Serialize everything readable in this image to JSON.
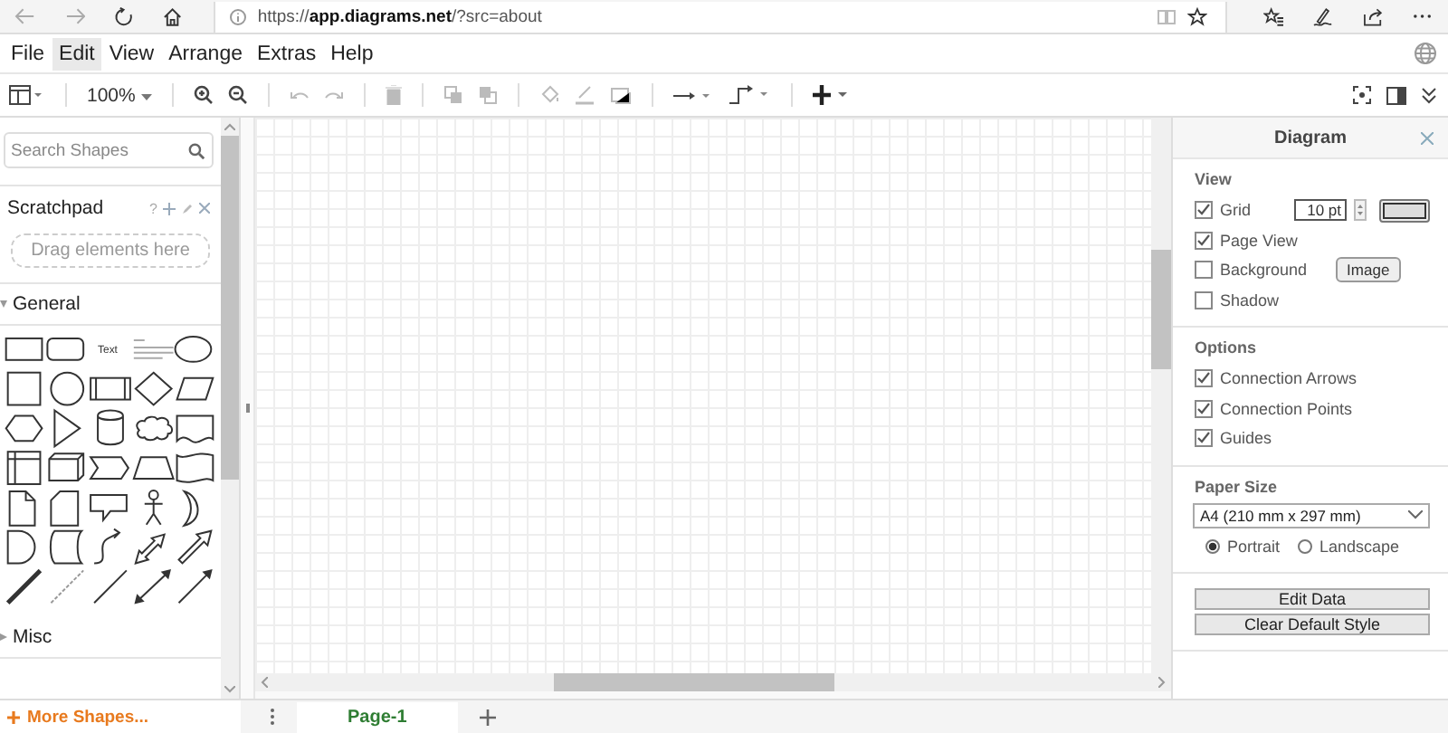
{
  "browser": {
    "url": "https://**app.diagrams.net**/?src=about"
  },
  "menu": [
    {
      "label": "File",
      "selected": false
    },
    {
      "label": "Edit",
      "selected": true
    },
    {
      "label": "View",
      "selected": false
    },
    {
      "label": "Arrange",
      "selected": false
    },
    {
      "label": "Extras",
      "selected": false
    },
    {
      "label": "Help",
      "selected": false
    }
  ],
  "toolbar": {
    "zoom": "100%"
  },
  "sidebar": {
    "search": {
      "placeholder": "Search Shapes"
    },
    "scratchpad": {
      "title": "Scratchpad",
      "help": "?",
      "drop_hint": "Drag elements here"
    },
    "sections": [
      {
        "title": "General",
        "expanded": true
      },
      {
        "title": "Misc",
        "expanded": false
      }
    ],
    "palette": {
      "text_label": "Text"
    },
    "more_shapes": "More Shapes..."
  },
  "pages": [
    {
      "label": "Page-1",
      "selected": true
    }
  ],
  "panel": {
    "title": "Diagram",
    "view": {
      "heading": "View",
      "grid_size": "10 pt",
      "image_button": "Image",
      "items": [
        {
          "label": "Grid",
          "checked": true,
          "kind": "grid"
        },
        {
          "label": "Page View",
          "checked": true,
          "kind": "plain"
        },
        {
          "label": "Background",
          "checked": false,
          "kind": "background"
        },
        {
          "label": "Shadow",
          "checked": false,
          "kind": "plain"
        }
      ]
    },
    "options": {
      "heading": "Options",
      "items": [
        {
          "label": "Connection Arrows",
          "checked": true
        },
        {
          "label": "Connection Points",
          "checked": true
        },
        {
          "label": "Guides",
          "checked": true
        }
      ]
    },
    "paper": {
      "heading": "Paper Size",
      "value": "A4 (210 mm x 297 mm)",
      "orientations": [
        {
          "label": "Portrait",
          "selected": true
        },
        {
          "label": "Landscape",
          "selected": false
        }
      ]
    },
    "buttons": [
      "Edit Data",
      "Clear Default Style"
    ]
  }
}
